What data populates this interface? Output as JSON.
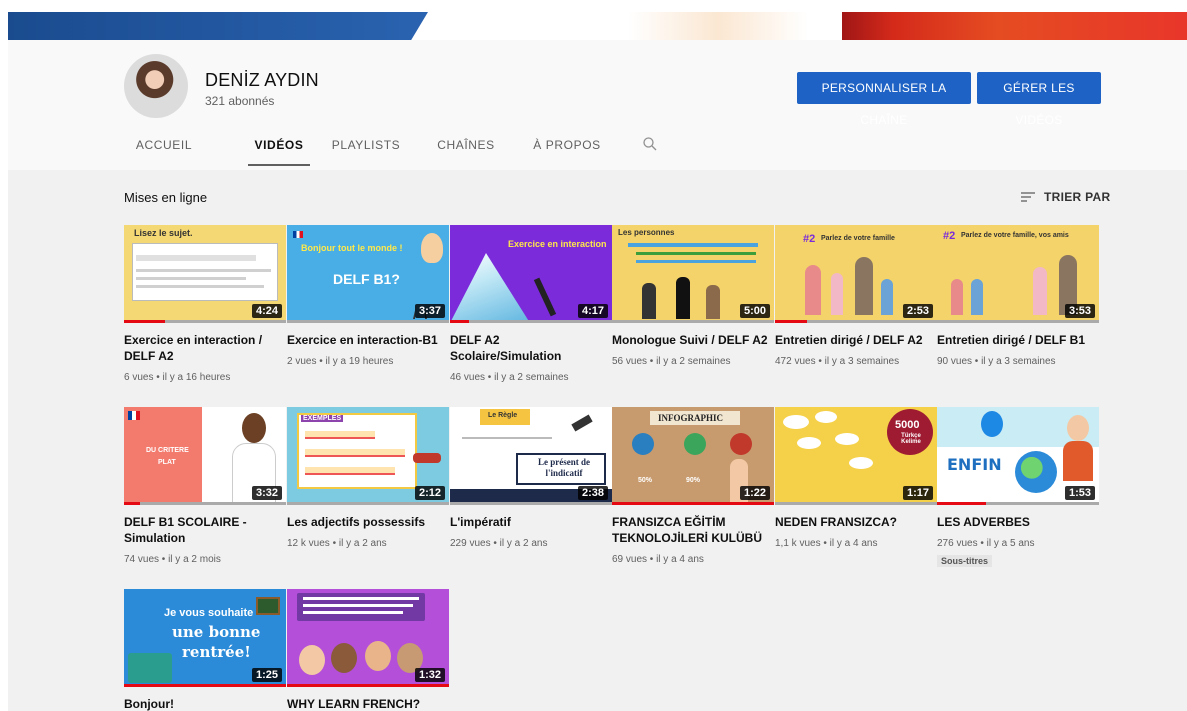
{
  "channel": {
    "name": "DENİZ AYDIN",
    "subscribers": "321 abonnés",
    "customize_label": "PERSONNALISER LA CHAÎNE",
    "manage_label": "GÉRER LES VIDÉOS"
  },
  "tabs": [
    {
      "label": "ACCUEIL",
      "active": false
    },
    {
      "label": "VIDÉOS",
      "active": true
    },
    {
      "label": "PLAYLISTS",
      "active": false
    },
    {
      "label": "CHAÎNES",
      "active": false
    },
    {
      "label": "À PROPOS",
      "active": false
    }
  ],
  "search_icon": "search-icon",
  "section": {
    "title": "Mises en ligne",
    "sort_label": "TRIER PAR",
    "sort_icon": "sort-icon"
  },
  "videos": [
    {
      "title": "Exercice en interaction / DELF A2",
      "meta": "6 vues • il y a 16 heures",
      "duration": "4:24",
      "progress": 0.25,
      "thumb_text": [
        "Lisez le sujet."
      ]
    },
    {
      "title": "Exercice en interaction-B1",
      "meta": "2 vues • il y a 19 heures",
      "duration": "3:37",
      "progress": 0.0,
      "thumb_text": [
        "Bonjour tout le monde !",
        "DELF B1?"
      ]
    },
    {
      "title": "DELF A2 Scolaire/Simulation",
      "meta": "46 vues • il y a 2 semaines",
      "duration": "4:17",
      "progress": 0.12,
      "thumb_text": [
        "Exercice en interaction"
      ]
    },
    {
      "title": "Monologue Suivi / DELF A2",
      "meta": "56 vues • il y a 2 semaines",
      "duration": "5:00",
      "progress": 0.0,
      "thumb_text": [
        "Les personnes"
      ]
    },
    {
      "title": "Entretien dirigé / DELF A2",
      "meta": "472 vues • il y a 3 semaines",
      "duration": "2:53",
      "progress": 0.2,
      "thumb_text": [
        "#2",
        "Parlez de votre famille"
      ]
    },
    {
      "title": "Entretien dirigé / DELF B1",
      "meta": "90 vues • il y a 3 semaines",
      "duration": "3:53",
      "progress": 0.0,
      "thumb_text": [
        "#2",
        "Parlez de votre famille, vos amis"
      ]
    },
    {
      "title": "DELF B1 SCOLAIRE - Simulation",
      "meta": "74 vues • il y a 2 mois",
      "duration": "3:32",
      "progress": 0.1,
      "thumb_text": [
        "DU CRITERE",
        "PLAT"
      ]
    },
    {
      "title": "Les adjectifs possessifs",
      "meta": "12 k vues • il y a 2 ans",
      "duration": "2:12",
      "progress": 0.0,
      "thumb_text": [
        "EXEMPLES"
      ]
    },
    {
      "title": "L'impératif",
      "meta": "229 vues • il y a 2 ans",
      "duration": "2:38",
      "progress": 0.0,
      "thumb_text": [
        "Le Règle",
        "Le présent de l'indicatif"
      ]
    },
    {
      "title": "FRANSIZCA EĞİTİM TEKNOLOJİLERİ KULÜBÜ",
      "meta": "69 vues • il y a 4 ans",
      "duration": "1:22",
      "progress": 1.0,
      "thumb_text": [
        "INFOGRAPHIC",
        "50%",
        "90%"
      ]
    },
    {
      "title": "NEDEN FRANSIZCA?",
      "meta": "1,1 k vues • il y a 4 ans",
      "duration": "1:17",
      "progress": 0.0,
      "thumb_text": [
        "5000",
        "Türkçe Kelime"
      ]
    },
    {
      "title": "LES ADVERBES",
      "meta": "276 vues • il y a 5 ans",
      "duration": "1:53",
      "progress": 0.3,
      "badge": "Sous-titres",
      "thumb_text": [
        "ENFIN"
      ]
    },
    {
      "title": "Bonjour!",
      "meta": "",
      "duration": "1:25",
      "progress": 1.0,
      "thumb_text": [
        "Je vous souhaite",
        "une bonne",
        "rentrée!"
      ]
    },
    {
      "title": "WHY LEARN FRENCH?",
      "meta": "",
      "duration": "1:32",
      "progress": 1.0,
      "thumb_text": []
    }
  ]
}
